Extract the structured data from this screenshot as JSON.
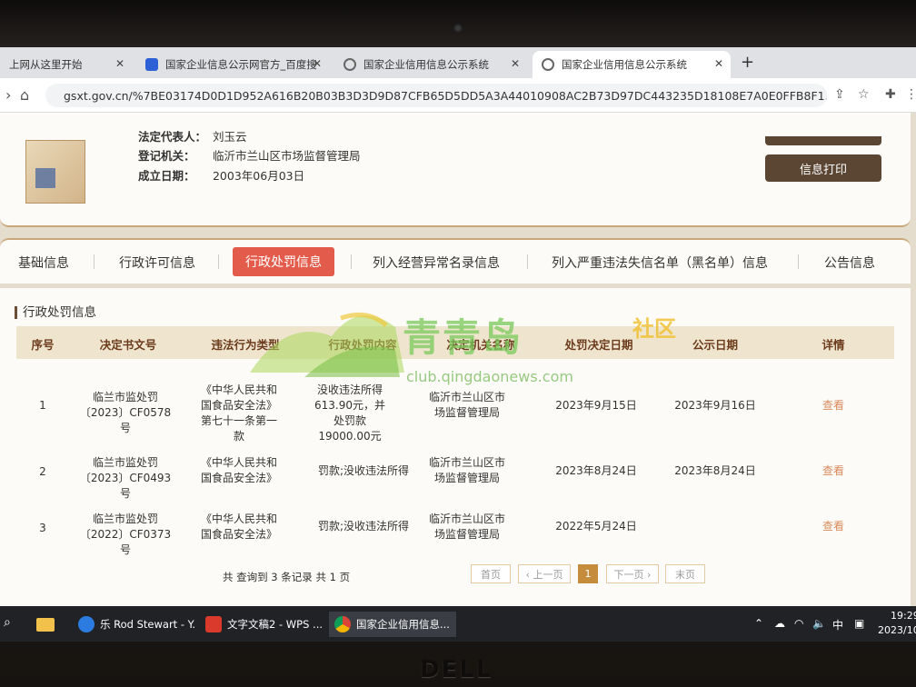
{
  "browser": {
    "tabs": [
      {
        "title": "上网从这里开始",
        "icon": "page-icon"
      },
      {
        "title": "国家企业信息公示网官方_百度搜",
        "icon": "baidu-icon"
      },
      {
        "title": "国家企业信用信息公示系统",
        "icon": "globe-icon"
      },
      {
        "title": "国家企业信用信息公示系统",
        "icon": "globe-icon",
        "active": true
      }
    ],
    "new_tab": "+",
    "url": "gsxt.gov.cn/%7BE03174D0D1D952A616B20B03B3D3D9D87CFB65D5DD5A3A44010908AC2B73D97DC443235D18108E7A0E0FFB8F1..."
  },
  "company": {
    "rows": [
      {
        "key": "法定代表人：",
        "value": "刘玉云"
      },
      {
        "key": "登记机关：",
        "value": "临沂市兰山区市场监督管理局"
      },
      {
        "key": "成立日期：",
        "value": "2003年06月03日"
      }
    ],
    "print_button": "信息打印"
  },
  "nav_tabs": [
    {
      "label": "基础信息"
    },
    {
      "label": "行政许可信息"
    },
    {
      "label": "行政处罚信息",
      "active": true
    },
    {
      "label": "列入经营异常名录信息"
    },
    {
      "label": "列入严重违法失信名单（黑名单）信息"
    },
    {
      "label": "公告信息"
    }
  ],
  "penalty": {
    "section_title": "行政处罚信息",
    "columns": [
      "序号",
      "决定书文号",
      "违法行为类型",
      "行政处罚内容",
      "决定机关名称",
      "处罚决定日期",
      "公示日期",
      "详情"
    ],
    "rows": [
      {
        "no": "1",
        "doc": "临兰市监处罚〔2023〕CF0578号",
        "type": "《中华人民共和国食品安全法》第七十一条第一款",
        "content": "没收违法所得613.90元，并处罚款19000.00元",
        "authority": "临沂市兰山区市场监督管理局",
        "decision_date": "2023年9月15日",
        "publish_date": "2023年9月16日",
        "detail": "查看"
      },
      {
        "no": "2",
        "doc": "临兰市监处罚〔2023〕CF0493号",
        "type": "《中华人民共和国食品安全法》",
        "content": "罚款;没收违法所得",
        "authority": "临沂市兰山区市场监督管理局",
        "decision_date": "2023年8月24日",
        "publish_date": "2023年8月24日",
        "detail": "查看"
      },
      {
        "no": "3",
        "doc": "临兰市监处罚〔2022〕CF0373号",
        "type": "《中华人民共和国食品安全法》",
        "content": "罚款;没收违法所得",
        "authority": "临沂市兰山区市场监督管理局",
        "decision_date": "2022年5月24日",
        "publish_date": "",
        "detail": "查看"
      }
    ],
    "summary": "共 查询到 3 条记录 共 1 页",
    "pager": {
      "first": "首页",
      "prev": "‹ 上一页",
      "current": "1",
      "next": "下一页 ›",
      "last": "末页"
    }
  },
  "watermark": {
    "brand": "青青岛",
    "suffix": "社区",
    "url": "club.qingdaonews.com"
  },
  "taskbar": {
    "items": [
      {
        "label": "乐 Rod Stewart - Y...",
        "icon": "kugou-icon"
      },
      {
        "label": "文字文稿2 - WPS ...",
        "icon": "wps-icon"
      },
      {
        "label": "国家企业信用信息...",
        "icon": "chrome-icon",
        "active": true
      }
    ],
    "time": "19:29",
    "date": "2023/10"
  },
  "laptop_brand": "DELL",
  "colors": {
    "accent_red": "#e35c4b",
    "brown": "#5b4533",
    "table_head": "#efe5cf",
    "link": "#d98a5b"
  }
}
